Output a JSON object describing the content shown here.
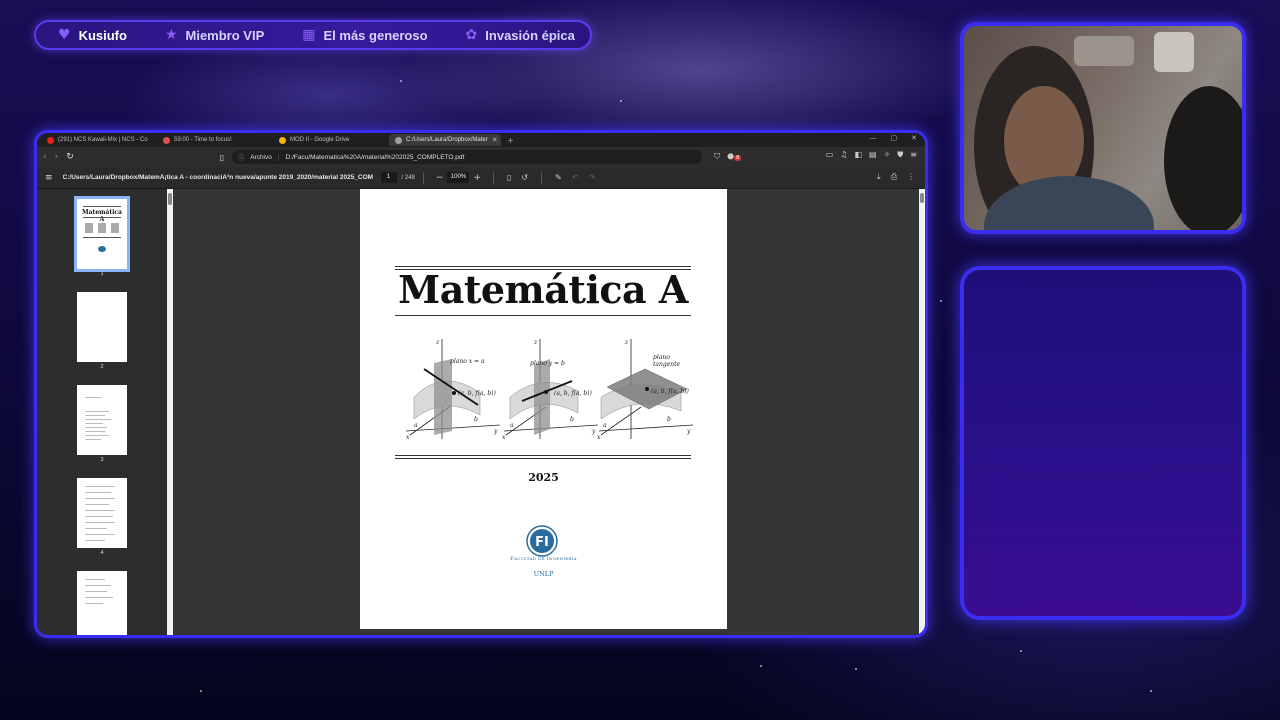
{
  "alerts_bar": {
    "items": [
      {
        "icon": "heart-icon",
        "label": "Kusiufo"
      },
      {
        "icon": "star-icon",
        "label": "Miembro VIP"
      },
      {
        "icon": "gift-icon",
        "label": "El más generoso"
      },
      {
        "icon": "paw-icon",
        "label": "Invasión épica"
      }
    ]
  },
  "browser": {
    "tabs": [
      {
        "label": "(291) NCS Kawaii-Mix | NCS - Co",
        "icon_color": "#e62117",
        "active": false
      },
      {
        "label": "59:00 - Time to focus!",
        "icon_color": "#d9534f",
        "active": false
      },
      {
        "label": "MOD II - Google Drive",
        "icon_color": "#f4b400",
        "active": false
      },
      {
        "label": "C:/Users/Laura/Dropbox/Mater",
        "icon_color": "#9aa0a6",
        "active": true
      }
    ],
    "address": {
      "scheme": "Archivo",
      "url": "D:/Facu/Matematica%20A/material%202025_COMPLETO.pdf",
      "extension_badge": "8"
    }
  },
  "pdf_viewer": {
    "file_title": "C:/Users/Laura/Dropbox/MatemÃ¡tica A - coordinaciÃ³n nueva/apunte 2019_2020/material 2025_COMP...",
    "current_page": "1",
    "page_total": "/ 248",
    "zoom": "100%",
    "thumbnails": [
      {
        "num": "1"
      },
      {
        "num": "2"
      },
      {
        "num": "3"
      },
      {
        "num": "4"
      }
    ]
  },
  "document": {
    "title": "Matemática A",
    "year": "2025",
    "faculty": "Facultad de Ingeniería",
    "university": "UNLP",
    "figure_labels": {
      "fig1_plane": "plano x = a",
      "fig1_point": "(a, b, f(a, b))",
      "fig2_plane": "plano y = b",
      "fig2_point": "(a, b, f(a, b))",
      "fig3_plane_1": "plano",
      "fig3_plane_2": "tangente",
      "fig3_point": "(a, b, f(a, b))",
      "axis_x": "x",
      "axis_y": "y",
      "axis_z": "z",
      "axis_a": "a",
      "axis_b": "b",
      "logo_letters": "FI"
    }
  }
}
